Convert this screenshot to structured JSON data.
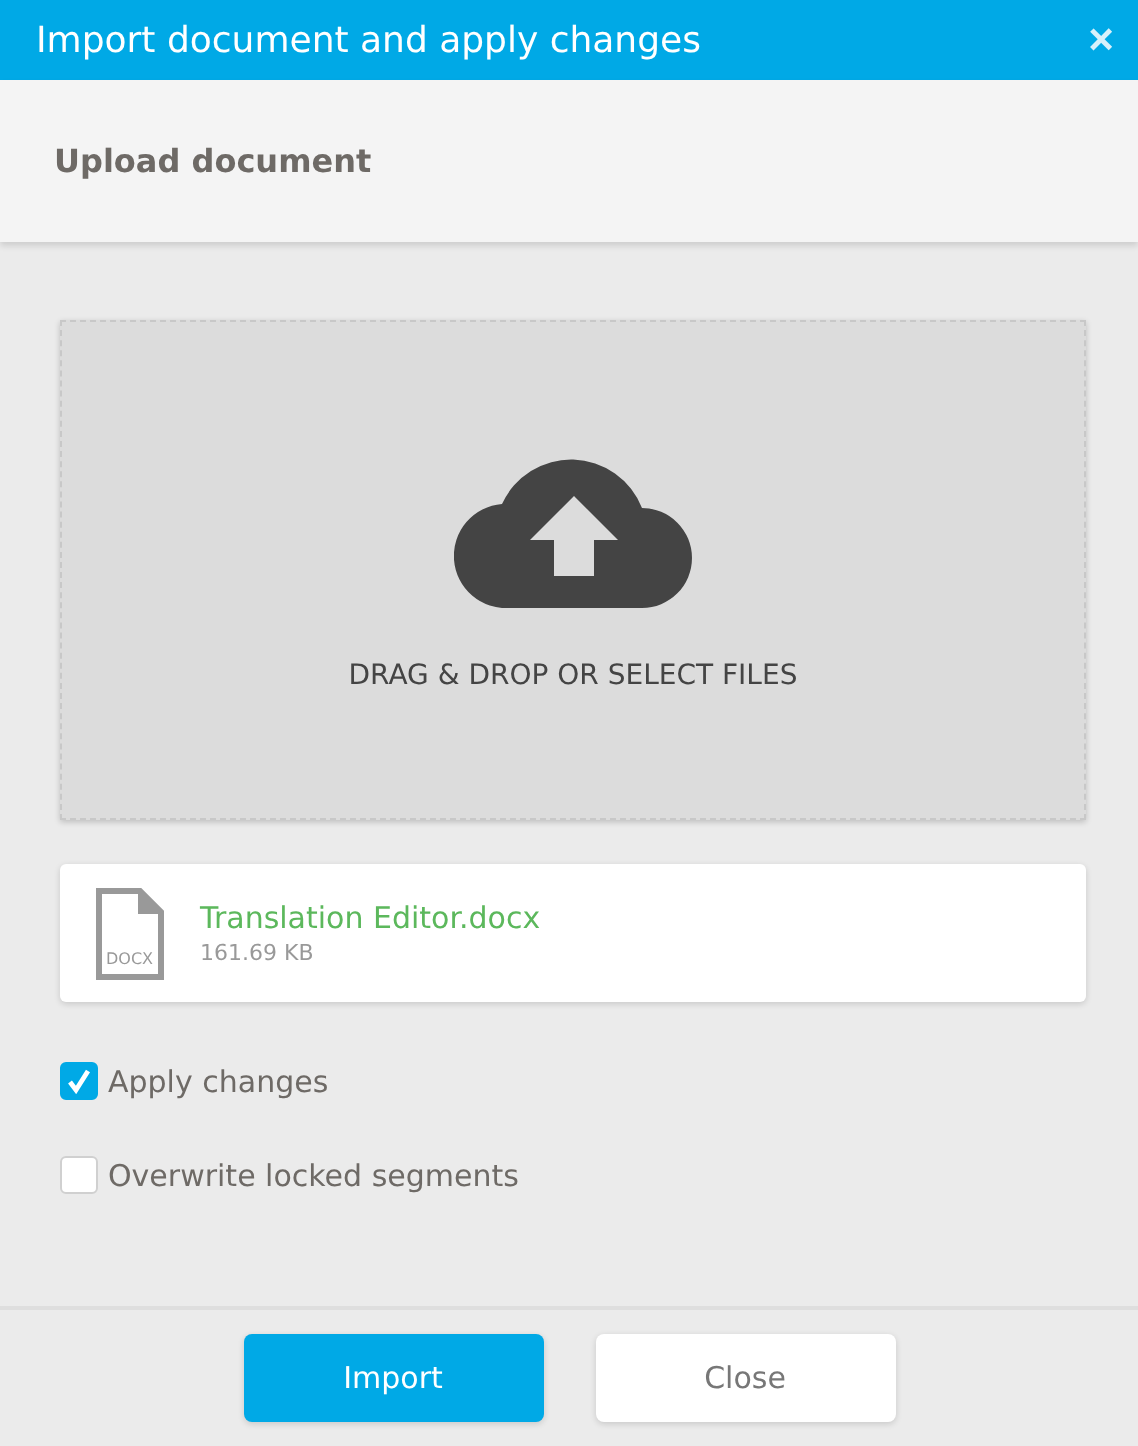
{
  "window": {
    "title": "Import document and apply changes",
    "close": "×"
  },
  "header": {
    "title": "Upload document"
  },
  "dropzone": {
    "label": "DRAG & DROP OR SELECT FILES"
  },
  "files": [
    {
      "type_label": "DOCX",
      "name": "Translation Editor.docx",
      "size": "161.69 KB"
    }
  ],
  "options": [
    {
      "label": "Apply changes",
      "checked": true
    },
    {
      "label": "Overwrite locked segments",
      "checked": false
    }
  ],
  "buttons": [
    {
      "label": "Import",
      "kind": "primary"
    },
    {
      "label": "Close",
      "kind": "secondary"
    }
  ]
}
